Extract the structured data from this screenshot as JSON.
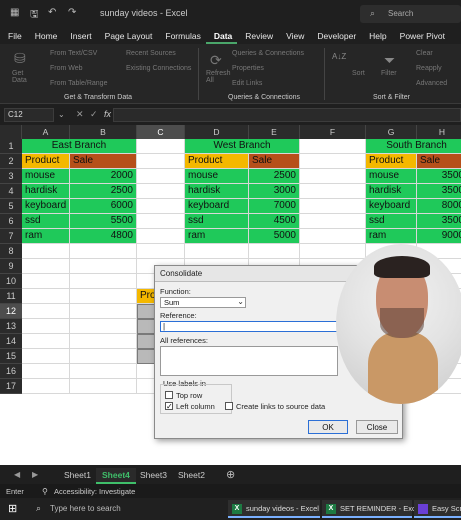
{
  "window": {
    "title": "sunday videos  -  Excel",
    "search": "Search"
  },
  "menu": [
    "File",
    "Home",
    "Insert",
    "Page Layout",
    "Formulas",
    "Data",
    "Review",
    "View",
    "Developer",
    "Help",
    "Power Pivot"
  ],
  "menu_active": "Data",
  "ribbon": {
    "get_data": "Get\nData",
    "from_text": "From Text/CSV",
    "from_web": "From Web",
    "from_table": "From Table/Range",
    "recent_sources": "Recent Sources",
    "existing_connections": "Existing Connections",
    "group_get": "Get & Transform Data",
    "refresh": "Refresh\nAll",
    "queries_connections": "Queries & Connections",
    "properties": "Properties",
    "edit_links": "Edit Links",
    "group_queries": "Queries & Connections",
    "sort": "Sort",
    "filter": "Filter",
    "clear": "Clear",
    "reapply": "Reapply",
    "advanced": "Advanced",
    "group_sort": "Sort & Filter"
  },
  "formula_bar": {
    "name_box": "C12",
    "fx": "fx",
    "value": ""
  },
  "columns": [
    "A",
    "B",
    "C",
    "D",
    "E",
    "F",
    "G",
    "H"
  ],
  "rows": [
    "1",
    "2",
    "3",
    "4",
    "5",
    "6",
    "7",
    "8",
    "9",
    "10",
    "11",
    "12",
    "13",
    "14",
    "15",
    "16",
    "17"
  ],
  "tables": [
    {
      "branch": "East Branch",
      "h1": "Product",
      "h2": "Sale",
      "rows": [
        [
          "mouse",
          "2000"
        ],
        [
          "hardisk",
          "2500"
        ],
        [
          "keyboard",
          "6000"
        ],
        [
          "ssd",
          "5500"
        ],
        [
          "ram",
          "4800"
        ]
      ]
    },
    {
      "branch": "West Branch",
      "h1": "Product",
      "h2": "Sale",
      "rows": [
        [
          "mouse",
          "2500"
        ],
        [
          "hardisk",
          "3000"
        ],
        [
          "keyboard",
          "7000"
        ],
        [
          "ssd",
          "4500"
        ],
        [
          "ram",
          "5000"
        ]
      ]
    },
    {
      "branch": "South Branch",
      "h1": "Product",
      "h2": "Sale",
      "rows": [
        [
          "mouse",
          "3500"
        ],
        [
          "hardisk",
          "3500"
        ],
        [
          "keyboard",
          "8000"
        ],
        [
          "ssd",
          "3500"
        ],
        [
          "ram",
          "9000"
        ]
      ]
    }
  ],
  "c11_partial": "Pro",
  "dialog": {
    "title": "Consolidate",
    "function_label": "Function:",
    "function_value": "Sum",
    "reference_label": "Reference:",
    "all_refs_label": "All references:",
    "use_labels": "Use labels in",
    "top_row": "Top row",
    "left_column": "Left column",
    "create_links": "Create links to source data",
    "ok": "OK",
    "close": "Close"
  },
  "sheets": [
    "Sheet1",
    "Sheet4",
    "Sheet3",
    "Sheet2"
  ],
  "active_sheet": "Sheet4",
  "status": {
    "mode": "Enter",
    "accessibility": "Accessibility: Investigate"
  },
  "taskbar": {
    "search": "Type here to search",
    "task1": "sunday videos - Excel",
    "task2": "SET REMINDER - Excel",
    "task3": "Easy Scr"
  },
  "colors": {
    "green": "#1fc95a",
    "orange": "#f4b800",
    "rust": "#b6501a",
    "accent": "#3fbf6a"
  }
}
